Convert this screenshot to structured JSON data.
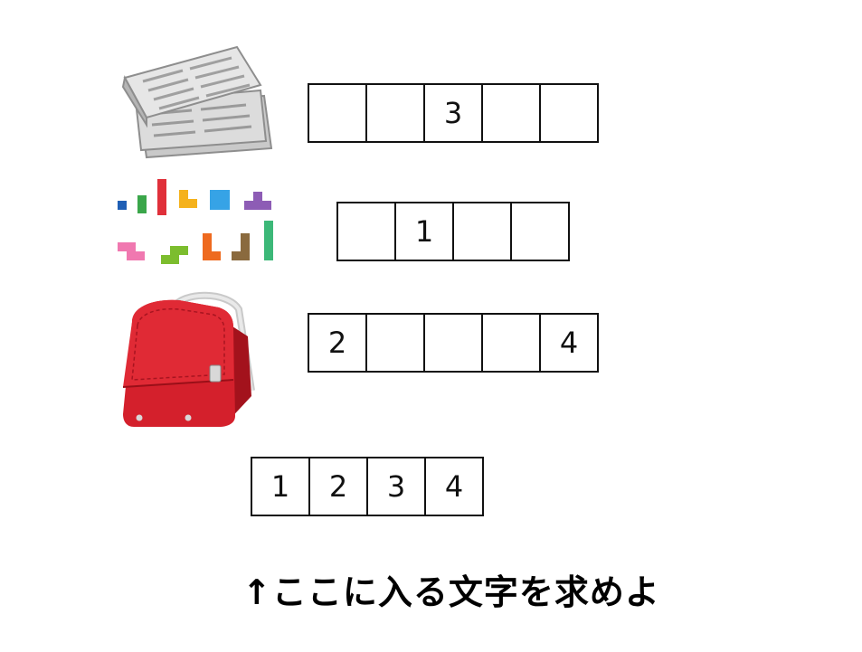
{
  "rows": [
    {
      "id": "newspaper",
      "picture": "newspaper-illustration",
      "cells": [
        "",
        "",
        "3",
        "",
        ""
      ]
    },
    {
      "id": "blocks",
      "picture": "tetromino-blocks-illustration",
      "cells": [
        "",
        "1",
        "",
        ""
      ]
    },
    {
      "id": "randoseru",
      "picture": "red-school-backpack-illustration",
      "cells": [
        "2",
        "",
        "",
        "",
        "4"
      ]
    }
  ],
  "answer_cells": [
    "1",
    "2",
    "3",
    "4"
  ],
  "caption": "↑ここに入る文字を求めよ"
}
